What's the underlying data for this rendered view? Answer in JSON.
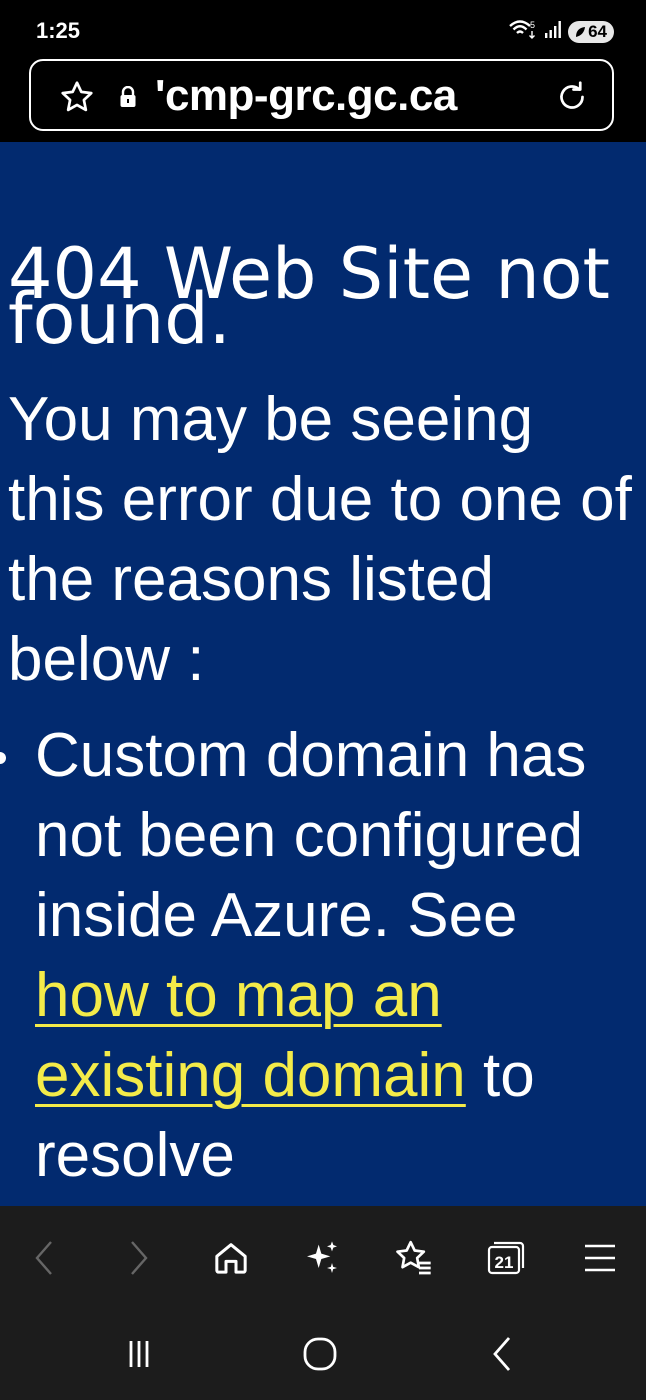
{
  "status_bar": {
    "time": "1:25",
    "battery": "64",
    "wifi_badge": "5"
  },
  "address_bar": {
    "url": "'cmp-grc.gc.ca"
  },
  "page": {
    "heading": "404 Web Site not found.",
    "intro": "You may be seeing this error due to one of the reasons listed below :",
    "reasons": [
      {
        "text_before": "Custom domain has not been configured inside Azure. See ",
        "link_text": "how to map an existing domain",
        "text_after": " to resolve"
      }
    ]
  },
  "toolbar": {
    "items": [
      "back-arrow-icon",
      "forward-arrow-icon",
      "home-icon",
      "sparkles-icon",
      "bookmark-star-icon",
      "tabs-icon",
      "menu-icon"
    ],
    "tab_count": "21"
  },
  "nav_bar": {
    "items": [
      "recent-apps-icon",
      "home-circle-icon",
      "back-chevron-icon"
    ]
  },
  "colors": {
    "page_background": "#022a6f",
    "link": "#f4eb49",
    "chrome": "#1c1c1c"
  }
}
